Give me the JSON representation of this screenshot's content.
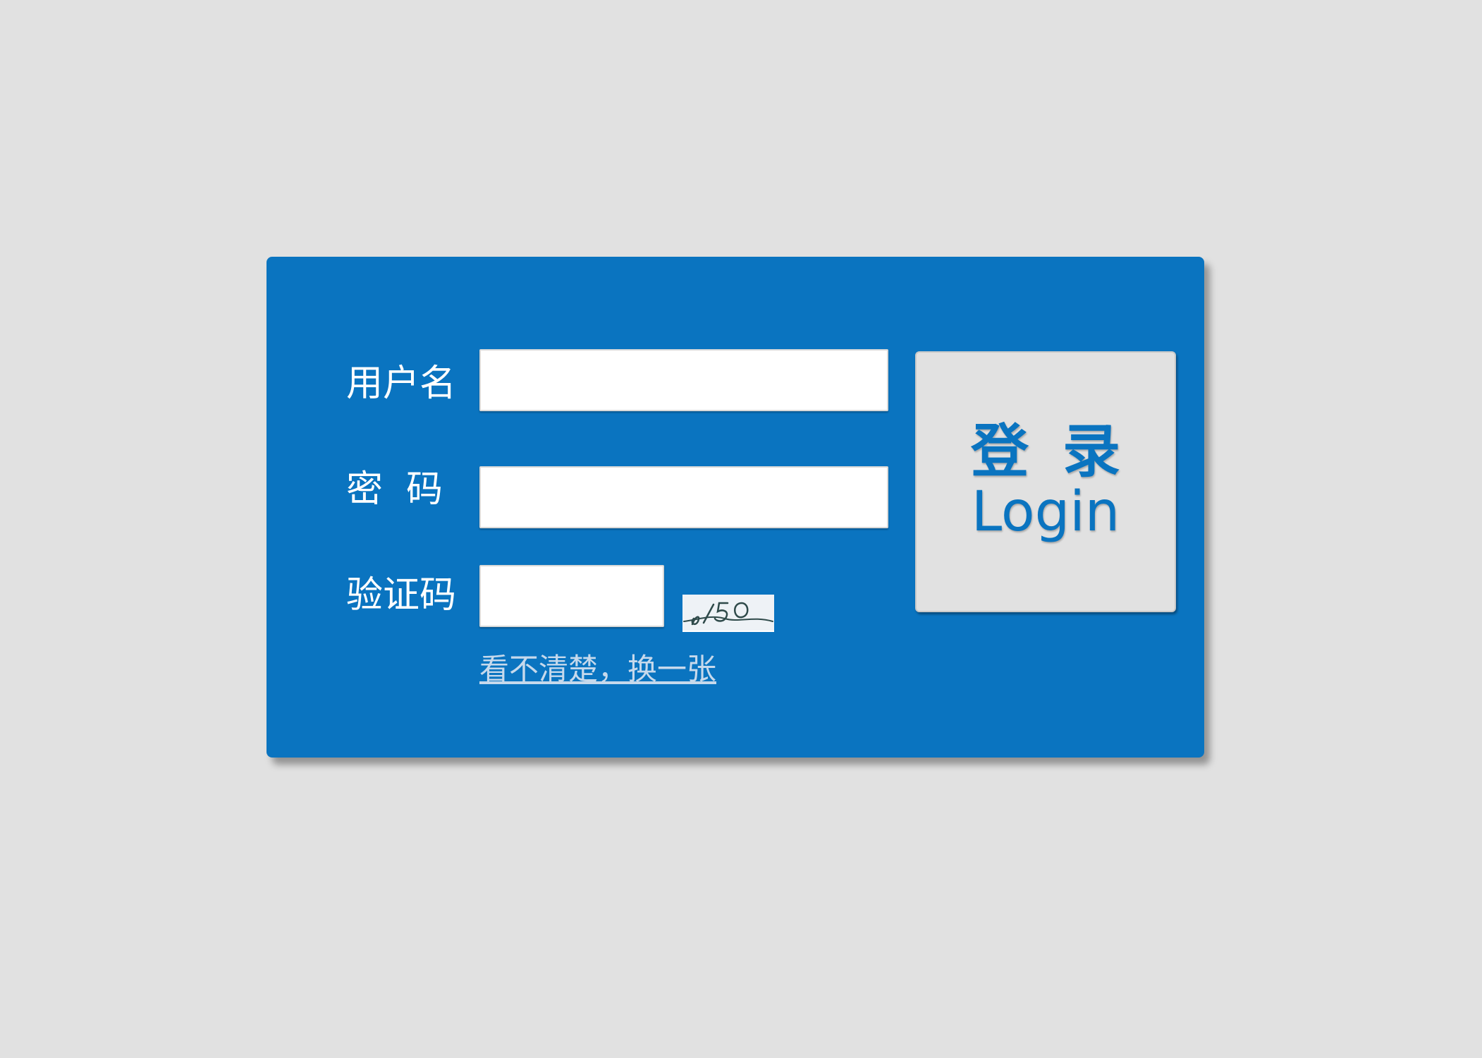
{
  "colors": {
    "background": "#e1e1e1",
    "panel": "#0a74c0",
    "label_text": "#ffffff",
    "link_text": "#c6d9ec",
    "button_background": "#e1e1e1",
    "button_text": "#0a74c0"
  },
  "form": {
    "username_label": "用户名",
    "password_label": "密  码",
    "captcha_label": "验证码",
    "username_value": "",
    "password_value": "",
    "captcha_value": "",
    "captcha_code": "6/50",
    "refresh_captcha_link": "看不清楚，换一张"
  },
  "login_button": {
    "label_cn": "登录",
    "label_en": "Login"
  }
}
